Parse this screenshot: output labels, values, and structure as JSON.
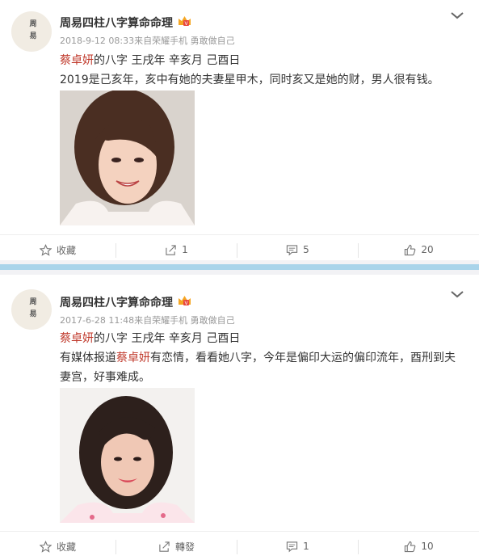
{
  "posts": [
    {
      "author": "周易四柱八字算命命理",
      "avatar_text": "周易",
      "meta": "2018-9-12 08:33来自荣耀手机 勇敢做自己",
      "line1": {
        "mention": "蔡卓妍",
        "rest": "的八字 王戌年 辛亥月 己酉日"
      },
      "body_lines": [
        "2019是己亥年，亥中有她的夫妻星甲木，同时亥又是她的财，男人很有钱。"
      ],
      "actions": {
        "favorite": "收藏",
        "repost": "1",
        "comment": "5",
        "like": "20"
      }
    },
    {
      "author": "周易四柱八字算命命理",
      "avatar_text": "周易",
      "meta": "2017-6-28 11:48来自荣耀手机 勇敢做自己",
      "line1": {
        "mention": "蔡卓妍",
        "rest": "的八字 王戌年 辛亥月 己酉日"
      },
      "line2": {
        "pre": "有媒体报道",
        "mention": "蔡卓妍",
        "post": "有恋情，看看她八字，今年是偏印大运的偏印流年，酉刑到夫"
      },
      "line3": "妻宫，好事难成。",
      "actions": {
        "favorite": "收藏",
        "repost": "轉發",
        "comment": "1",
        "like": "10"
      }
    }
  ],
  "icons": {
    "favorite": "star-outline-icon",
    "repost": "share-arrow-icon",
    "comment": "comment-bubble-icon",
    "like": "thumbs-up-icon",
    "menu": "chevron-down-icon",
    "badge": "vip-crown-badge-icon"
  },
  "colors": {
    "mention": "#c0392b",
    "meta": "#999999",
    "divider_accent": "#a9d4ea",
    "vip_badge": "#f5a623"
  }
}
